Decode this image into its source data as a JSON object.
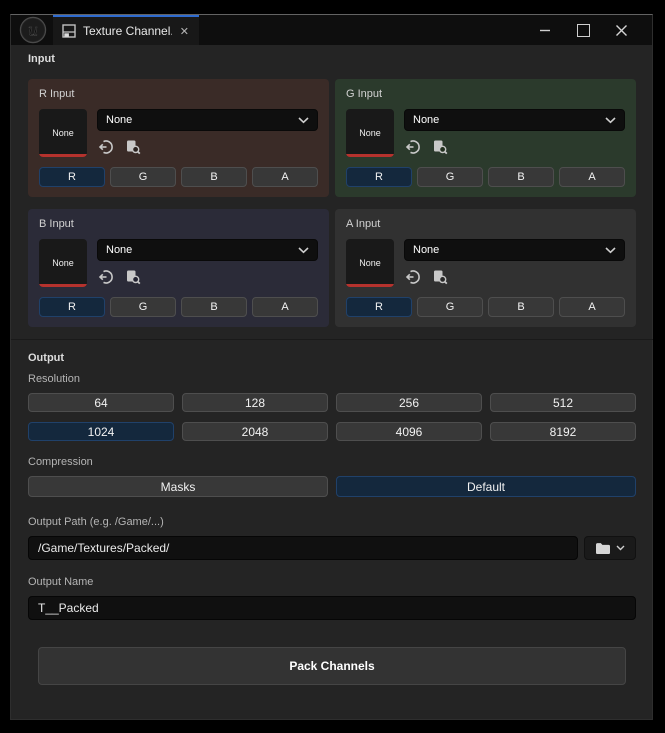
{
  "titlebar": {
    "tab_title": "Texture Channel...",
    "close_glyph": "✕",
    "minimize_glyph": "—"
  },
  "input_section": {
    "label": "Input",
    "thumbnail_placeholder": "None",
    "channels": [
      {
        "label": "R Input",
        "thumbnail_text": "None",
        "dropdown_value": "None",
        "channel_buttons": [
          "R",
          "G",
          "B",
          "A"
        ],
        "selected_channel": "R"
      },
      {
        "label": "G Input",
        "thumbnail_text": "None",
        "dropdown_value": "None",
        "channel_buttons": [
          "R",
          "G",
          "B",
          "A"
        ],
        "selected_channel": "R"
      },
      {
        "label": "B Input",
        "thumbnail_text": "None",
        "dropdown_value": "None",
        "channel_buttons": [
          "R",
          "G",
          "B",
          "A"
        ],
        "selected_channel": "R"
      },
      {
        "label": "A Input",
        "thumbnail_text": "None",
        "dropdown_value": "None",
        "channel_buttons": [
          "R",
          "G",
          "B",
          "A"
        ],
        "selected_channel": "R"
      }
    ]
  },
  "output_section": {
    "label": "Output",
    "resolution_label": "Resolution",
    "resolutions": [
      "64",
      "128",
      "256",
      "512",
      "1024",
      "2048",
      "4096",
      "8192"
    ],
    "selected_resolution": "1024",
    "compression_label": "Compression",
    "compression_options": [
      "Masks",
      "Default"
    ],
    "selected_compression": "Default",
    "output_path_label": "Output Path (e.g. /Game/...)",
    "output_path_value": "/Game/Textures/Packed/",
    "output_name_label": "Output Name",
    "output_name_value": "T__Packed",
    "pack_button_label": "Pack Channels"
  },
  "colors": {
    "selected_button_bg": "#14283d",
    "tab_accent_blue": "#2e6bd0",
    "panel_r_bg": "#3a2b27",
    "panel_g_bg": "#2b3a2c",
    "panel_b_bg": "#2b2b38",
    "panel_a_bg": "#313131",
    "thumbnail_underline_red": "#b5322d",
    "window_bg": "#242424",
    "titlebar_bg": "#0e0e0e"
  }
}
